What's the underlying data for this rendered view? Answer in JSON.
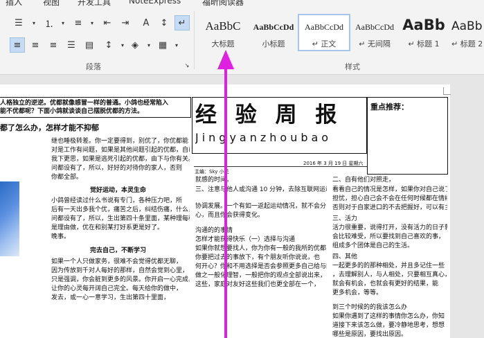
{
  "tabs": [
    "插入",
    "视图",
    "开发工具",
    "NoteExpress",
    "福昕阅读器"
  ],
  "groups": {
    "paragraph": "段落",
    "styles": "样式"
  },
  "styles": [
    {
      "preview": "AaBbC",
      "name": "大标题"
    },
    {
      "preview": "AaBbCcDd",
      "name": "小标题"
    },
    {
      "preview": "AaBbCcDd",
      "name": "正文"
    },
    {
      "preview": "AaBbCcDd",
      "name": "无间隔"
    },
    {
      "preview": "AaBb",
      "name": "标题 1"
    },
    {
      "preview": "AaBb",
      "name": "标题 2"
    }
  ],
  "doc": {
    "masthead_title": "经 验 周 报",
    "masthead_pinyin": "Jingyanzhoubao",
    "date": "2016 年 3 月 19 日 星期六",
    "author": "主编：Sky 小花",
    "sidebar_title": "重点推荐：",
    "left_top_1": "人格独立的逆逆。优都就像感冒一样的普通。小鸽也经常陷入",
    "left_top_2": "能不优都呢？下面小鸽就谈谈自己摆脱优都的方法。",
    "left_heading": "都了怎么办，怎样才能不抑郁",
    "col1_lines": [
      "继也睡极转差。你一定要得到，别优了，你优都能",
      "对是工作有间题，如果是其他间题引起的优都，自已",
      "我下更思，如果是逃死引起的优都，由下与你有关。",
      "问都设有了，所以，好好的对待你的家人，否则",
      "你都全部。"
    ],
    "col1_h1": "觉好运动，本灵生命",
    "col1_p1": [
      "小鸽曾经读过什么书说有专门，各种压力吧，所",
      "后有一天出多我个优，痛苦之后，纠结伤痛，什么，",
      "问都设有了，所以，生出第四十条里面，某种理每种",
      "是理由做，优在和别某打好系更是好了。",
      "晚事。"
    ],
    "col1_h2": "完去自己，不断学习",
    "col1_p2": [
      "如果一个人只做家务，很难不会觉得优都无聊，",
      "因为传放到千对人每好的那样，自然会觉到心里，",
      "只是强调，你会脏到更多的风景。你开启一心完成，",
      "让你的心灵每开阔自己完全。每天给你的做中，",
      "发去，或一心一意学习，生出第四十里面，"
    ],
    "col2_lines": [
      "就感的时间。",
      "三、注意与他人或沟通 10 分钟，去除互联网运动。",
      "协调发展。一个有如一返起运动情况，就不会分",
      "心，而且你会获得变化。"
    ],
    "col2_h1": "沟通的的事情",
    "col2_h2": "怎样才能获得快乐（一）选择与沟通",
    "col2_p": [
      "如果你就想要找人，你为你有一般的我所的优都，",
      "你要把过去的事放下，有个朋友听你说说，也",
      "何开心？你和不用选择是否会参照更多自己给与的",
      "做之一般化理智，一般把你的观点全部说出来，",
      "这些，家庭对友好这些我们也更全部在一个，"
    ],
    "col3_lines": [
      "二、自有他们对照走，",
      "看看自己的情况是怎样，如果你对自己说了为",
      "担忧，担心自己会不会在任何时候都在情绪，",
      "否则对于自家进口的不去把握好，可以有主要"
    ],
    "col3_h1": "三、活力",
    "col3_p": [
      "活力很重要，说得打开，没有活力的日子就",
      "会比较难受，所以要找到自己喜欢的事，",
      "组成多个团体是自己的生活。"
    ],
    "col3_h2": "四、其他",
    "col3_p2": [
      "一起更多的的那种相处，并且多记住一些",
      "，去理解别人，与人相处，只要相互真心，",
      "就会有机会，也就会有更好的结果，能",
      "更多机会，等等。"
    ],
    "col3_h3": "到三个时候的的我该怎么办",
    "col3_p3": [
      "如果你遇到了这样的事情你怎么办，你知",
      "道接下来该怎么做，要冷静地思考，想想",
      "哪些是原因，要找出原因。"
    ]
  }
}
